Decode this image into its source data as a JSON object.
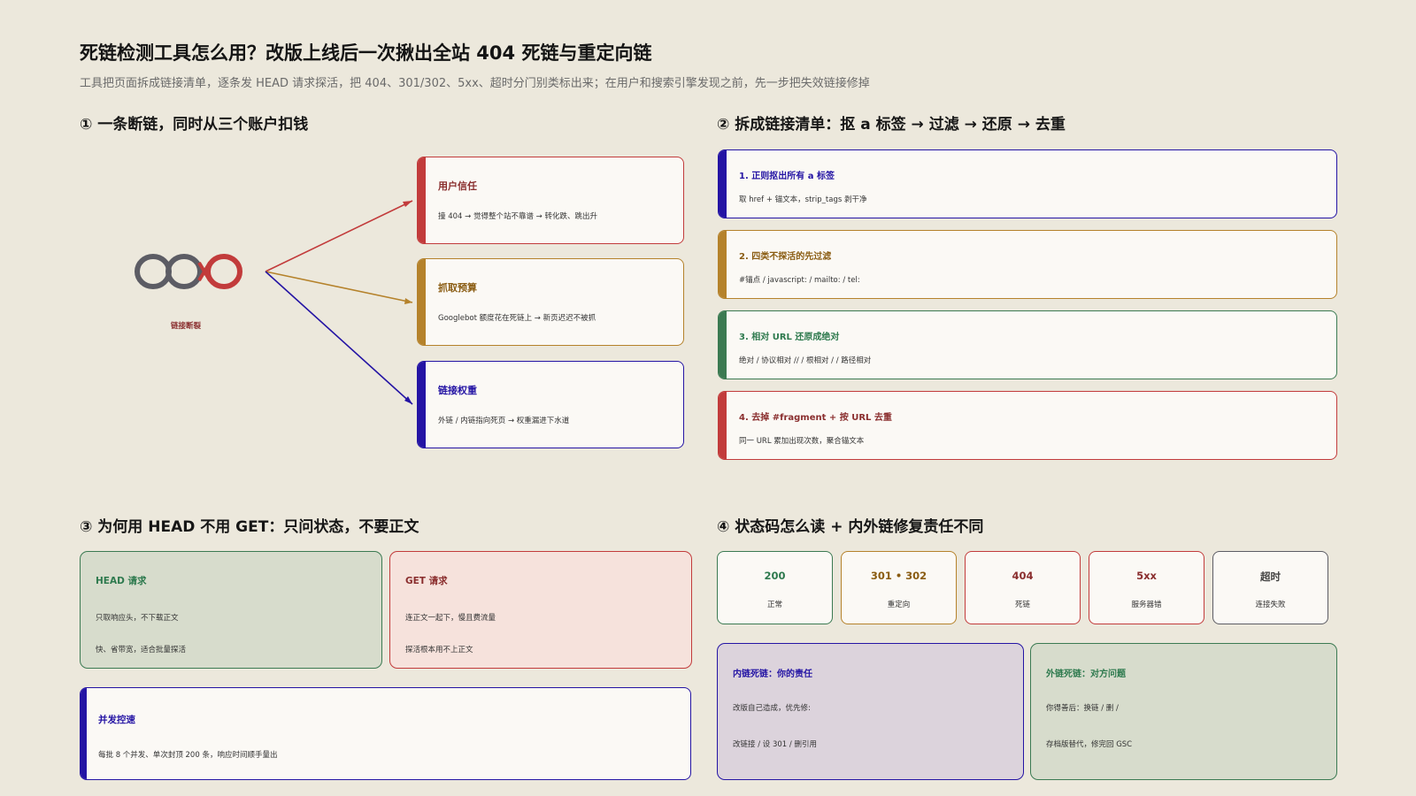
{
  "header": {
    "title": "死链检测工具怎么用？改版上线后一次揪出全站 404 死链与重定向链",
    "subtitle": "工具把页面拆成链接清单，逐条发 HEAD 请求探活，把 404、301/302、5xx、超时分门别类标出来；在用户和搜索引擎发现之前，先一步把失效链接修掉"
  },
  "colors": {
    "red": "#c23b3b",
    "orange": "#b5822b",
    "blue": "#2414a4",
    "green": "#3b7a52",
    "gray": "#5c5c64",
    "background": "#ece8dc"
  },
  "section1": {
    "title": "① 一条断链，同时从三个账户扣钱",
    "chain_label": "链接断裂",
    "cards": [
      {
        "title": "用户信任",
        "desc": "撞 404 → 觉得整个站不靠谱 → 转化跌、跳出升"
      },
      {
        "title": "抓取预算",
        "desc": "Googlebot 额度花在死链上 → 新页迟迟不被抓"
      },
      {
        "title": "链接权重",
        "desc": "外链 / 内链指向死页 → 权重漏进下水道"
      }
    ]
  },
  "section2": {
    "title": "② 拆成链接清单：抠 a 标签 → 过滤 → 还原 → 去重",
    "steps": [
      {
        "title": "1. 正则抠出所有 a 标签",
        "desc": "取 href + 锚文本，strip_tags 剥干净"
      },
      {
        "title": "2. 四类不探活的先过滤",
        "desc": "#锚点 / javascript: / mailto: / tel:"
      },
      {
        "title": "3. 相对 URL 还原成绝对",
        "desc": "绝对 / 协议相对 // / 根相对 / / 路径相对"
      },
      {
        "title": "4. 去掉 #fragment + 按 URL 去重",
        "desc": "同一 URL 累加出现次数，聚合锚文本"
      }
    ]
  },
  "section3": {
    "title": "③ 为何用 HEAD 不用 GET：只问状态，不要正文",
    "head": {
      "title": "HEAD 请求",
      "lines": [
        "只取响应头，不下载正文",
        "快、省带宽，适合批量探活"
      ]
    },
    "get": {
      "title": "GET 请求",
      "lines": [
        "连正文一起下，慢且费流量",
        "探活根本用不上正文"
      ]
    },
    "concurrency": {
      "title": "并发控速",
      "desc": "每批 8 个并发、单次封顶 200 条，响应时间顺手量出"
    }
  },
  "section4": {
    "title": "④ 状态码怎么读 + 内外链修复责任不同",
    "codes": [
      {
        "code": "200",
        "label": "正常"
      },
      {
        "code": "301 • 302",
        "label": "重定向"
      },
      {
        "code": "404",
        "label": "死链"
      },
      {
        "code": "5xx",
        "label": "服务器错"
      },
      {
        "code": "超时",
        "label": "连接失败"
      }
    ],
    "internal": {
      "title": "内链死链：你的责任",
      "lines": [
        "改版自己造成，优先修:",
        "改链接 / 设 301 / 删引用"
      ]
    },
    "external": {
      "title": "外链死链：对方问题",
      "lines": [
        "你得善后：换链 / 删 /",
        "存档版替代，修完回 GSC"
      ]
    }
  }
}
